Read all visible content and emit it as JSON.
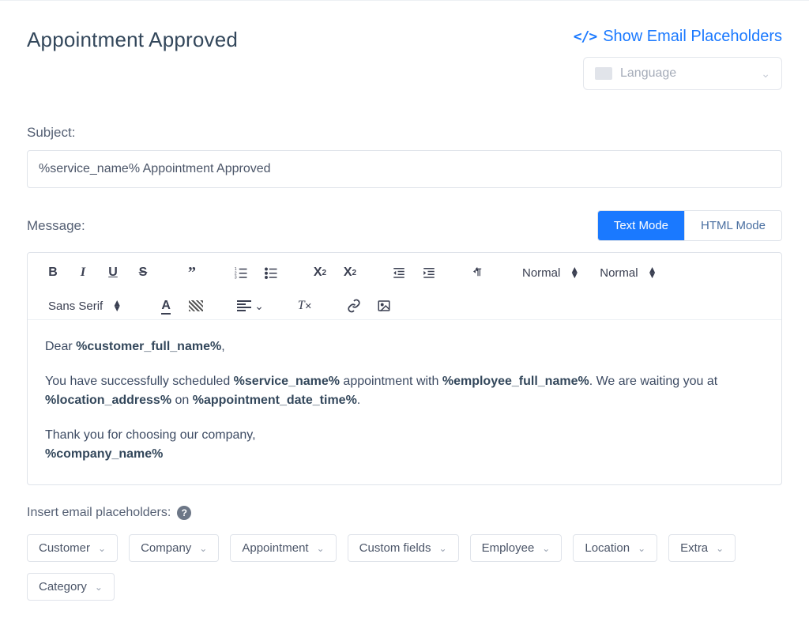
{
  "page": {
    "title": "Appointment Approved"
  },
  "actions": {
    "show_placeholders": "Show Email Placeholders"
  },
  "language_selector": {
    "placeholder": "Language"
  },
  "subject": {
    "label": "Subject:",
    "value": "%service_name% Appointment Approved"
  },
  "message": {
    "label": "Message:",
    "tabs": {
      "text": "Text Mode",
      "html": "HTML Mode",
      "active": "text"
    },
    "toolbar": {
      "dropdowns": {
        "heading": "Normal",
        "size": "Normal",
        "font": "Sans Serif"
      }
    },
    "body": {
      "p1_pre": "Dear ",
      "p1_b1": "%customer_full_name%",
      "p1_post": ",",
      "p2_a": "You have successfully scheduled ",
      "p2_b1": "%service_name%",
      "p2_b": " appointment with ",
      "p2_b2": "%employee_full_name%",
      "p2_c": ". We are waiting you at ",
      "p2_b3": "%location_address%",
      "p2_d": " on ",
      "p2_b4": "%appointment_date_time%",
      "p2_e": ".",
      "p3": "Thank you for choosing our company,",
      "p4_b1": "%company_name%"
    }
  },
  "placeholders": {
    "label": "Insert email placeholders:",
    "items": [
      "Customer",
      "Company",
      "Appointment",
      "Custom fields",
      "Employee",
      "Location",
      "Extra",
      "Category"
    ]
  }
}
